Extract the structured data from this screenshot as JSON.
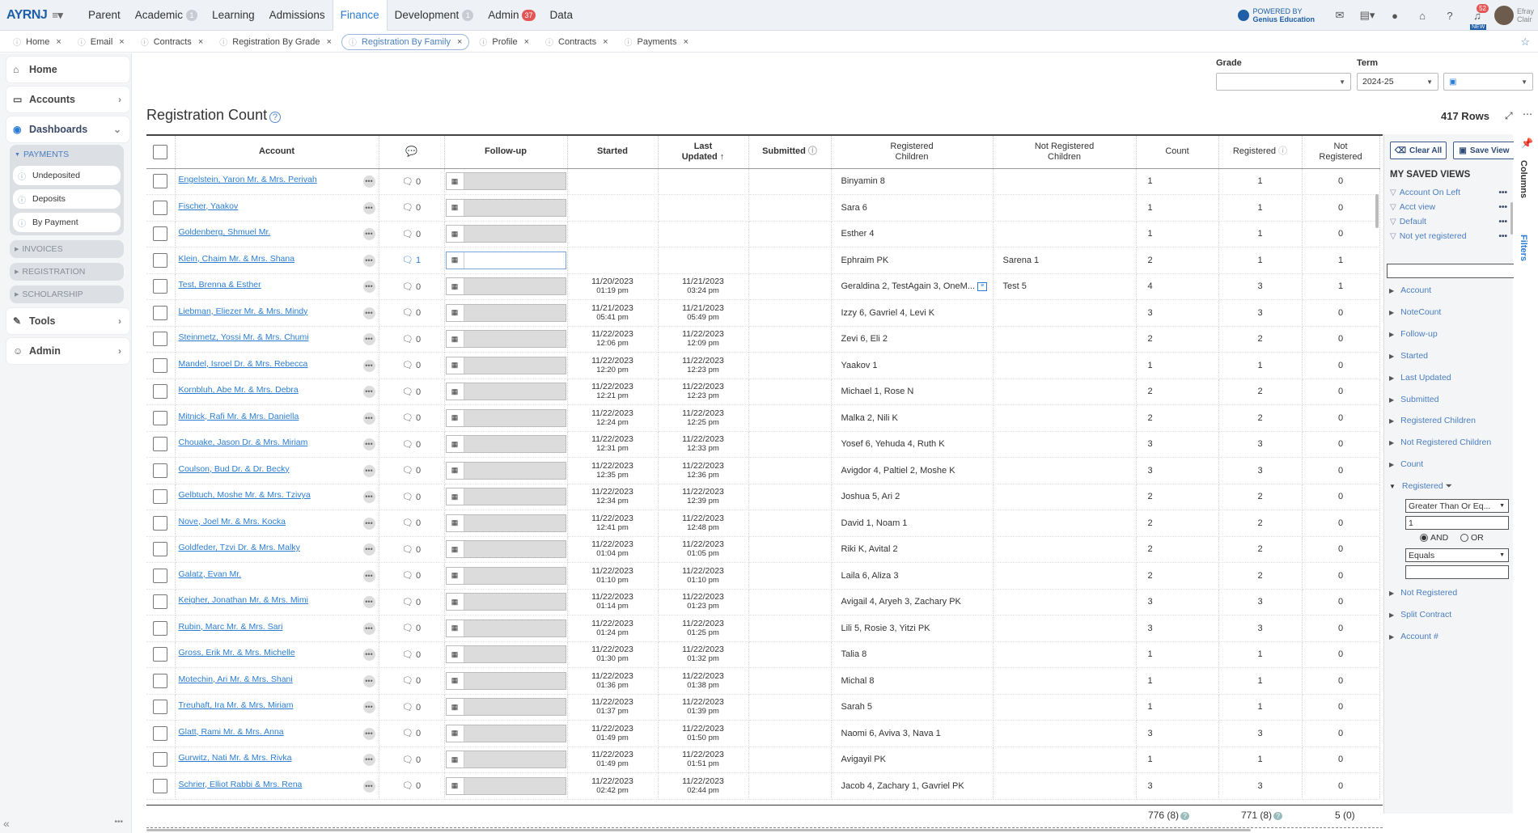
{
  "nav": {
    "logo": "AYRNJ",
    "items": [
      {
        "label": "Parent",
        "badge": ""
      },
      {
        "label": "Academic",
        "badge": "1"
      },
      {
        "label": "Learning",
        "badge": ""
      },
      {
        "label": "Admissions",
        "badge": ""
      },
      {
        "label": "Finance",
        "badge": "",
        "active": true
      },
      {
        "label": "Development",
        "badge": "1"
      },
      {
        "label": "Admin",
        "badge": "37"
      },
      {
        "label": "Data",
        "badge": ""
      }
    ],
    "powered_line1": "POWERED BY",
    "powered_line2": "Genius Education",
    "notif_count": "52",
    "new_label": "NEW",
    "user_first": "Efray",
    "user_last": "Clair"
  },
  "tabs": [
    {
      "label": "Home"
    },
    {
      "label": "Email"
    },
    {
      "label": "Contracts"
    },
    {
      "label": "Registration By Grade"
    },
    {
      "label": "Registration By Family",
      "active": true
    },
    {
      "label": "Profile"
    },
    {
      "label": "Contracts"
    },
    {
      "label": "Payments"
    }
  ],
  "sidebar": {
    "home": "Home",
    "accounts": "Accounts",
    "dashboards": "Dashboards",
    "payments": "PAYMENTS",
    "undeposited": "Undeposited",
    "deposits": "Deposits",
    "by_payment": "By Payment",
    "invoices": "INVOICES",
    "registration": "REGISTRATION",
    "scholarship": "SCHOLARSHIP",
    "tools": "Tools",
    "admin": "Admin"
  },
  "filters": {
    "grade_label": "Grade",
    "grade_value": "",
    "term_label": "Term",
    "term_value": "2024-25"
  },
  "page": {
    "title": "Registration Count",
    "row_count": "417 Rows"
  },
  "columns": {
    "account": "Account",
    "followup": "Follow-up",
    "started": "Started",
    "last_updated": "Last\nUpdated",
    "submitted": "Submitted",
    "registered_children": "Registered\nChildren",
    "not_registered_children": "Not Registered\nChildren",
    "count": "Count",
    "registered": "Registered",
    "not_registered": "Not\nRegistered"
  },
  "rows": [
    {
      "account": "Engelstein, Yaron Mr. & Mrs. Perivah",
      "notes": "0",
      "started_d": "",
      "started_t": "",
      "updated_d": "",
      "updated_t": "",
      "reg_children": "Binyamin 8",
      "notreg_children": "",
      "count": "1",
      "registered": "1",
      "not_registered": "0"
    },
    {
      "account": "Fischer, Yaakov",
      "notes": "0",
      "started_d": "",
      "started_t": "",
      "updated_d": "",
      "updated_t": "",
      "reg_children": "Sara 6",
      "notreg_children": "",
      "count": "1",
      "registered": "1",
      "not_registered": "0"
    },
    {
      "account": "Goldenberg, Shmuel Mr.",
      "notes": "0",
      "started_d": "",
      "started_t": "",
      "updated_d": "",
      "updated_t": "",
      "reg_children": "Esther 4",
      "notreg_children": "",
      "count": "1",
      "registered": "1",
      "not_registered": "0"
    },
    {
      "account": "Klein, Chaim Mr. & Mrs. Shana",
      "notes": "1",
      "started_d": "",
      "started_t": "",
      "updated_d": "",
      "updated_t": "",
      "reg_children": "Ephraim PK",
      "notreg_children": "Sarena 1",
      "count": "2",
      "registered": "1",
      "not_registered": "1"
    },
    {
      "account": "Test, Brenna & Esther",
      "notes": "0",
      "started_d": "11/20/2023",
      "started_t": "01:19 pm",
      "updated_d": "11/21/2023",
      "updated_t": "03:24 pm",
      "reg_children": "Geraldina 2, TestAgain 3, OneM...",
      "notreg_children": "Test 5",
      "count": "4",
      "registered": "3",
      "not_registered": "1"
    },
    {
      "account": "Liebman, Eliezer Mr. & Mrs. Mindy",
      "notes": "0",
      "started_d": "11/21/2023",
      "started_t": "05:41 pm",
      "updated_d": "11/21/2023",
      "updated_t": "05:49 pm",
      "reg_children": "Izzy 6, Gavriel 4, Levi K",
      "notreg_children": "",
      "count": "3",
      "registered": "3",
      "not_registered": "0"
    },
    {
      "account": "Steinmetz, Yossi Mr. & Mrs. Chumi",
      "notes": "0",
      "started_d": "11/22/2023",
      "started_t": "12:06 pm",
      "updated_d": "11/22/2023",
      "updated_t": "12:09 pm",
      "reg_children": "Zevi 6, Eli 2",
      "notreg_children": "",
      "count": "2",
      "registered": "2",
      "not_registered": "0"
    },
    {
      "account": "Mandel, Isroel Dr. & Mrs. Rebecca",
      "notes": "0",
      "started_d": "11/22/2023",
      "started_t": "12:20 pm",
      "updated_d": "11/22/2023",
      "updated_t": "12:23 pm",
      "reg_children": "Yaakov 1",
      "notreg_children": "",
      "count": "1",
      "registered": "1",
      "not_registered": "0"
    },
    {
      "account": "Kornbluh, Abe Mr. & Mrs. Debra",
      "notes": "0",
      "started_d": "11/22/2023",
      "started_t": "12:21 pm",
      "updated_d": "11/22/2023",
      "updated_t": "12:23 pm",
      "reg_children": "Michael 1, Rose N",
      "notreg_children": "",
      "count": "2",
      "registered": "2",
      "not_registered": "0"
    },
    {
      "account": "Mitnick, Rafi Mr. & Mrs. Daniella",
      "notes": "0",
      "started_d": "11/22/2023",
      "started_t": "12:24 pm",
      "updated_d": "11/22/2023",
      "updated_t": "12:25 pm",
      "reg_children": "Malka 2, Nili K",
      "notreg_children": "",
      "count": "2",
      "registered": "2",
      "not_registered": "0"
    },
    {
      "account": "Chouake, Jason Dr. & Mrs. Miriam",
      "notes": "0",
      "started_d": "11/22/2023",
      "started_t": "12:31 pm",
      "updated_d": "11/22/2023",
      "updated_t": "12:33 pm",
      "reg_children": "Yosef 6, Yehuda 4, Ruth K",
      "notreg_children": "",
      "count": "3",
      "registered": "3",
      "not_registered": "0"
    },
    {
      "account": "Coulson, Bud Dr. & Dr. Becky",
      "notes": "0",
      "started_d": "11/22/2023",
      "started_t": "12:35 pm",
      "updated_d": "11/22/2023",
      "updated_t": "12:36 pm",
      "reg_children": "Avigdor 4, Paltiel 2, Moshe K",
      "notreg_children": "",
      "count": "3",
      "registered": "3",
      "not_registered": "0"
    },
    {
      "account": "Gelbtuch, Moshe Mr. & Mrs. Tzivya",
      "notes": "0",
      "started_d": "11/22/2023",
      "started_t": "12:34 pm",
      "updated_d": "11/22/2023",
      "updated_t": "12:39 pm",
      "reg_children": "Joshua 5, Ari 2",
      "notreg_children": "",
      "count": "2",
      "registered": "2",
      "not_registered": "0"
    },
    {
      "account": "Nove, Joel Mr. & Mrs. Kocka",
      "notes": "0",
      "started_d": "11/22/2023",
      "started_t": "12:41 pm",
      "updated_d": "11/22/2023",
      "updated_t": "12:48 pm",
      "reg_children": "David 1, Noam 1",
      "notreg_children": "",
      "count": "2",
      "registered": "2",
      "not_registered": "0"
    },
    {
      "account": "Goldfeder, Tzvi Dr. & Mrs. Malky",
      "notes": "0",
      "started_d": "11/22/2023",
      "started_t": "01:04 pm",
      "updated_d": "11/22/2023",
      "updated_t": "01:05 pm",
      "reg_children": "Riki K, Avital 2",
      "notreg_children": "",
      "count": "2",
      "registered": "2",
      "not_registered": "0"
    },
    {
      "account": "Galatz, Evan Mr.",
      "notes": "0",
      "started_d": "11/22/2023",
      "started_t": "01:10 pm",
      "updated_d": "11/22/2023",
      "updated_t": "01:10 pm",
      "reg_children": "Laila 6, Aliza 3",
      "notreg_children": "",
      "count": "2",
      "registered": "2",
      "not_registered": "0"
    },
    {
      "account": "Keigher, Jonathan Mr. & Mrs. Mimi",
      "notes": "0",
      "started_d": "11/22/2023",
      "started_t": "01:14 pm",
      "updated_d": "11/22/2023",
      "updated_t": "01:23 pm",
      "reg_children": "Avigail 4, Aryeh 3, Zachary PK",
      "notreg_children": "",
      "count": "3",
      "registered": "3",
      "not_registered": "0"
    },
    {
      "account": "Rubin, Marc Mr. & Mrs. Sari",
      "notes": "0",
      "started_d": "11/22/2023",
      "started_t": "01:24 pm",
      "updated_d": "11/22/2023",
      "updated_t": "01:25 pm",
      "reg_children": "Lili 5, Rosie 3, Yitzi PK",
      "notreg_children": "",
      "count": "3",
      "registered": "3",
      "not_registered": "0"
    },
    {
      "account": "Gross, Erik Mr. & Mrs. Michelle",
      "notes": "0",
      "started_d": "11/22/2023",
      "started_t": "01:30 pm",
      "updated_d": "11/22/2023",
      "updated_t": "01:32 pm",
      "reg_children": "Talia 8",
      "notreg_children": "",
      "count": "1",
      "registered": "1",
      "not_registered": "0"
    },
    {
      "account": "Motechin, Ari Mr. & Mrs. Shani",
      "notes": "0",
      "started_d": "11/22/2023",
      "started_t": "01:36 pm",
      "updated_d": "11/22/2023",
      "updated_t": "01:38 pm",
      "reg_children": "Michal 8",
      "notreg_children": "",
      "count": "1",
      "registered": "1",
      "not_registered": "0"
    },
    {
      "account": "Treuhaft, Ira Mr. & Mrs. Miriam",
      "notes": "0",
      "started_d": "11/22/2023",
      "started_t": "01:37 pm",
      "updated_d": "11/22/2023",
      "updated_t": "01:39 pm",
      "reg_children": "Sarah 5",
      "notreg_children": "",
      "count": "1",
      "registered": "1",
      "not_registered": "0"
    },
    {
      "account": "Glatt, Rami Mr. & Mrs. Anna",
      "notes": "0",
      "started_d": "11/22/2023",
      "started_t": "01:49 pm",
      "updated_d": "11/22/2023",
      "updated_t": "01:50 pm",
      "reg_children": "Naomi 6, Aviva 3, Nava 1",
      "notreg_children": "",
      "count": "3",
      "registered": "3",
      "not_registered": "0"
    },
    {
      "account": "Gurwitz, Nati Mr. & Mrs. Rivka",
      "notes": "0",
      "started_d": "11/22/2023",
      "started_t": "01:49 pm",
      "updated_d": "11/22/2023",
      "updated_t": "01:51 pm",
      "reg_children": "Avigayil PK",
      "notreg_children": "",
      "count": "1",
      "registered": "1",
      "not_registered": "0"
    },
    {
      "account": "Schrier, Elliot Rabbi & Mrs. Rena",
      "notes": "0",
      "started_d": "11/22/2023",
      "started_t": "02:42 pm",
      "updated_d": "11/22/2023",
      "updated_t": "02:44 pm",
      "reg_children": "Jacob 4, Zachary 1, Gavriel PK",
      "notreg_children": "",
      "count": "3",
      "registered": "3",
      "not_registered": "0"
    }
  ],
  "totals": {
    "count": "776 (8)",
    "registered": "771 (8)",
    "not_registered": "5 (0)"
  },
  "panel": {
    "clear_all": "Clear All",
    "save_view": "Save View",
    "saved_views_heading": "MY SAVED VIEWS",
    "saved_views": [
      "Account On Left",
      "Acct view",
      "Default",
      "Not yet registered"
    ],
    "columns_tab": "Columns",
    "filters_tab": "Filters",
    "columns": [
      "Account",
      "NoteCount",
      "Follow-up",
      "Started",
      "Last Updated",
      "Submitted",
      "Registered Children",
      "Not Registered Children",
      "Count",
      "Registered"
    ],
    "columns_after": [
      "Not Registered",
      "Split Contract",
      "Account #"
    ],
    "filter_op1": "Greater Than Or Eq...",
    "filter_val1": "1",
    "and_label": "AND",
    "or_label": "OR",
    "filter_op2": "Equals",
    "filter_val2": ""
  }
}
